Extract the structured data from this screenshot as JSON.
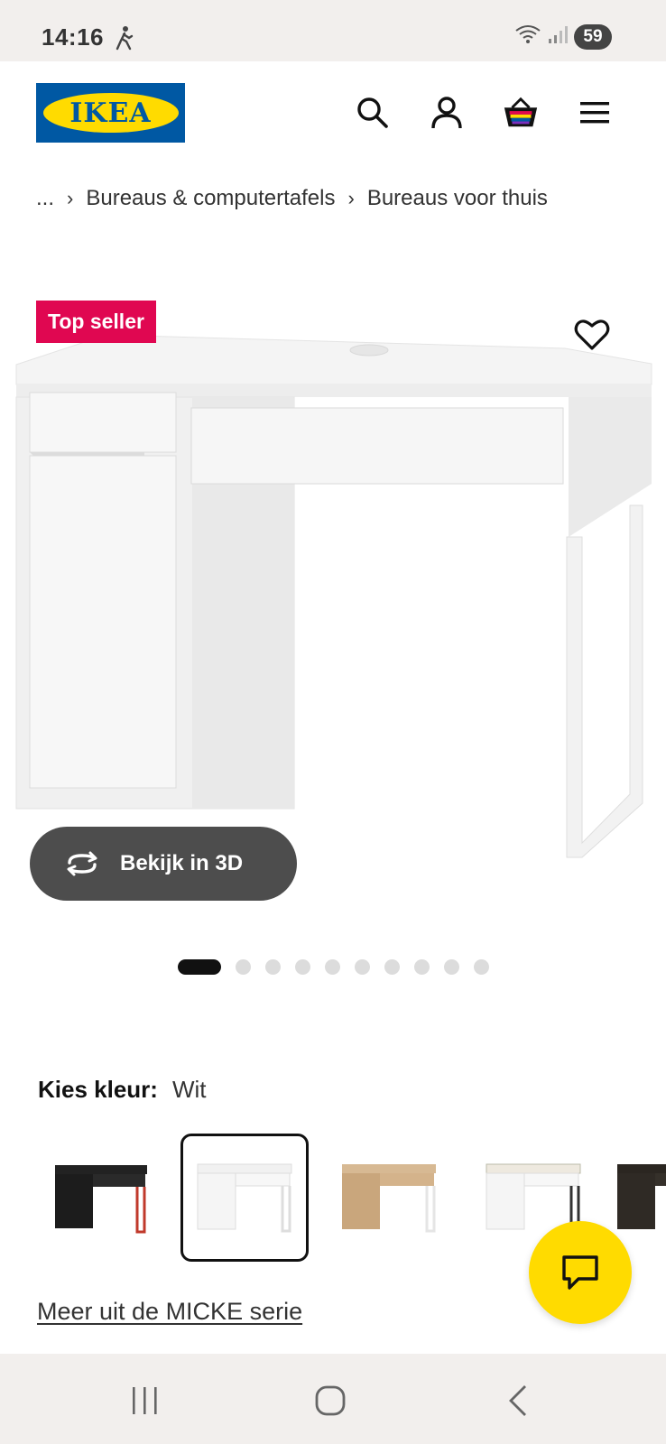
{
  "status_bar": {
    "time": "14:16",
    "battery": "59"
  },
  "header": {
    "logo_text": "IKEA",
    "icons": [
      "search-icon",
      "account-icon",
      "basket-icon",
      "menu-icon"
    ]
  },
  "breadcrumb": {
    "ellipsis": "...",
    "items": [
      "Bureaus & computertafels",
      "Bureaus voor thuis"
    ]
  },
  "product": {
    "badge": "Top seller",
    "view_3d_label": "Bekijk in 3D",
    "carousel": {
      "total": 10,
      "active_index": 0
    }
  },
  "color": {
    "label": "Kies kleur:",
    "selected": "Wit",
    "swatches": [
      {
        "name": "black-red",
        "selected": false
      },
      {
        "name": "white",
        "selected": true
      },
      {
        "name": "oak",
        "selected": false
      },
      {
        "name": "white-anthracite",
        "selected": false
      },
      {
        "name": "black-brown",
        "selected": false
      }
    ]
  },
  "series_link": "Meer uit de MICKE serie",
  "colors": {
    "accent_yellow": "#ffdb00",
    "ikea_blue": "#0058a3",
    "badge_red": "#e00751"
  }
}
